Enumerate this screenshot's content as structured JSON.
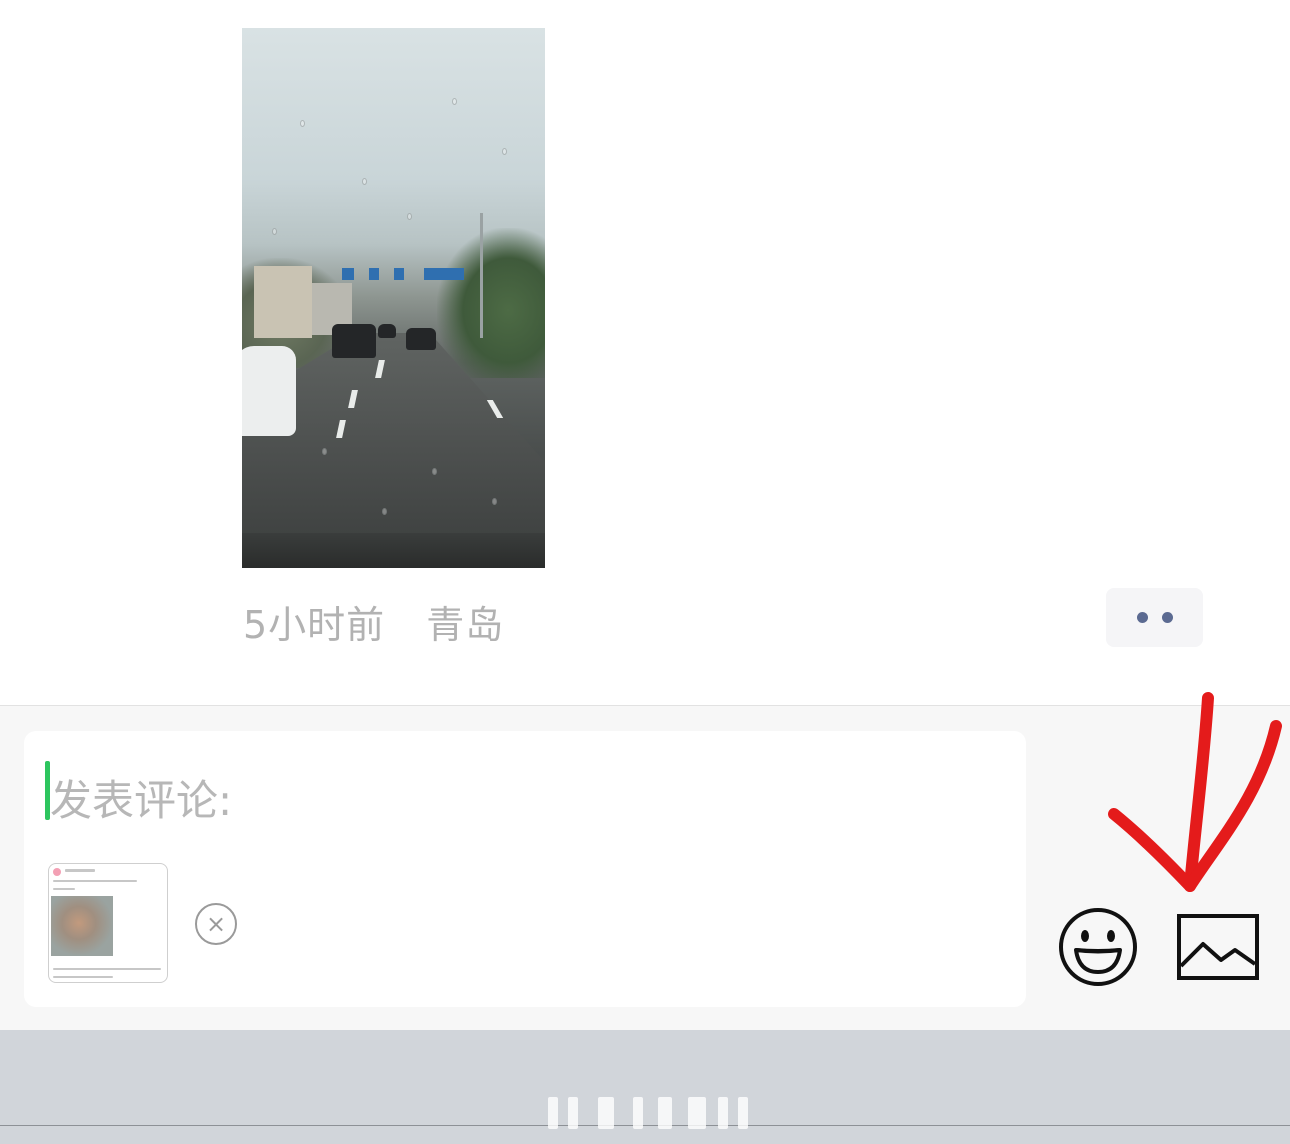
{
  "post": {
    "time": "5小时前",
    "location": "青岛"
  },
  "comment": {
    "placeholder": "发表评论:",
    "remove_symbol": "×"
  },
  "icons": {
    "more": "more-dots-icon",
    "emoji": "emoji-icon",
    "image": "image-icon",
    "remove": "close-circle-icon"
  },
  "colors": {
    "cursor": "#2dc55e",
    "more_dots": "#5b6a91",
    "annotation_arrow": "#e41b1b"
  }
}
